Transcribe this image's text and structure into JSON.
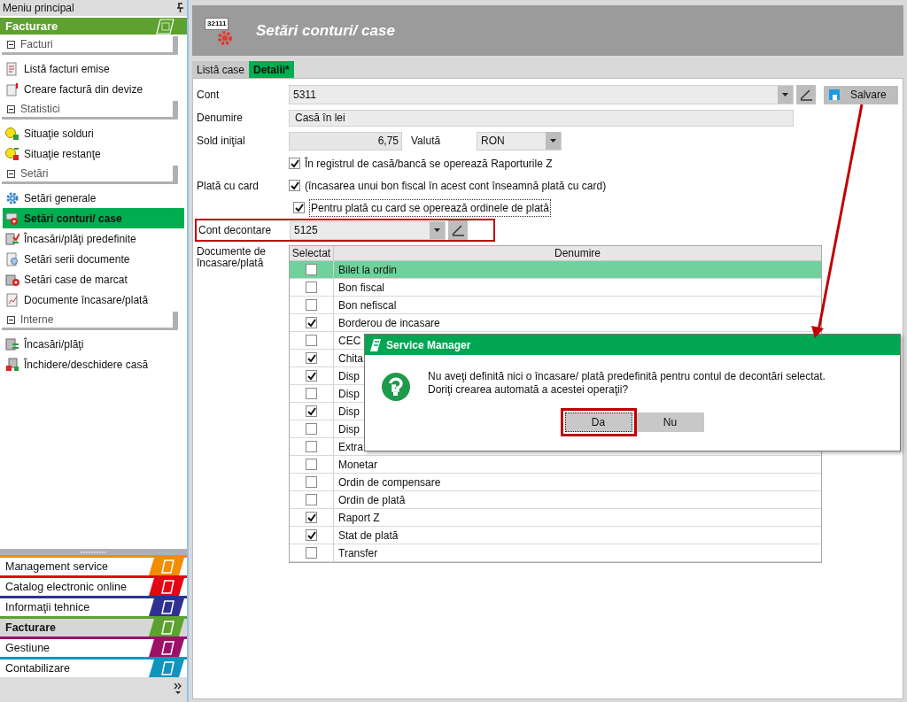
{
  "sidebar": {
    "title": "Meniu principal",
    "module": "Facturare",
    "groups": [
      {
        "label": "Facturi",
        "expanded": true,
        "items": [
          {
            "label": "Listă facturi emise",
            "selected": false
          },
          {
            "label": "Creare factură din devize",
            "selected": false
          }
        ]
      },
      {
        "label": "Statistici",
        "expanded": true,
        "items": [
          {
            "label": "Situaţie solduri",
            "selected": false
          },
          {
            "label": "Situaţie restanţe",
            "selected": false
          }
        ]
      },
      {
        "label": "Setări",
        "expanded": true,
        "items": [
          {
            "label": "Setări generale",
            "selected": false
          },
          {
            "label": "Setări conturi/ case",
            "selected": true
          },
          {
            "label": "Încasări/plăţi predefinite",
            "selected": false
          },
          {
            "label": "Setări serii documente",
            "selected": false
          },
          {
            "label": "Setări case de marcat",
            "selected": false
          },
          {
            "label": "Documente încasare/plată",
            "selected": false
          }
        ]
      },
      {
        "label": "Interne",
        "expanded": true,
        "items": [
          {
            "label": "Încasări/plăţi",
            "selected": false
          },
          {
            "label": "Închidere/deschidere casă",
            "selected": false
          }
        ]
      }
    ],
    "modules": [
      {
        "label": "Management service",
        "color": "#f28c00",
        "selected": false
      },
      {
        "label": "Catalog electronic online",
        "color": "#e30613",
        "selected": false
      },
      {
        "label": "Informaţii tehnice",
        "color": "#2e3192",
        "selected": false
      },
      {
        "label": "Facturare",
        "color": "#5da12e",
        "selected": true
      },
      {
        "label": "Gestiune",
        "color": "#9e1068",
        "selected": false
      },
      {
        "label": "Contabilizare",
        "color": "#0f95bd",
        "selected": false
      }
    ]
  },
  "header": {
    "icon_text": "32111",
    "title": "Setări conturi/ case"
  },
  "tabs": [
    {
      "label": "Listă case",
      "selected": false
    },
    {
      "label": "Detalii*",
      "selected": true
    }
  ],
  "form": {
    "cont_label": "Cont",
    "cont": "5311",
    "denumire_label": "Denumire",
    "denumire": "Casă în lei",
    "sold_label": "Sold iniţial",
    "sold": "6,75",
    "valuta_label": "Valută",
    "valuta": "RON",
    "options": [
      {
        "label": "În registrul de casă/bancă se operează Raporturile Z",
        "checked": true
      },
      {
        "label": "(încasarea unui bon fiscal în acest cont înseamnă plată cu card)",
        "checked": true
      },
      {
        "label": "Pentru plată cu card se operează ordinele de plată",
        "checked": true
      }
    ],
    "card_label": "Plată cu card",
    "decontare_label": "Cont decontare",
    "decontare": "5125",
    "documents_label": "Documente de încasare/plată"
  },
  "save_button": "Salvare",
  "table": {
    "columns": [
      "Selectat",
      "Denumire"
    ],
    "rows": [
      {
        "name": "Bilet la ordin",
        "checked": false,
        "selected": true
      },
      {
        "name": "Bon fiscal",
        "checked": false,
        "selected": false
      },
      {
        "name": "Bon nefiscal",
        "checked": false,
        "selected": false
      },
      {
        "name": "Borderou de incasare",
        "checked": true,
        "selected": false
      },
      {
        "name": "CEC",
        "checked": false,
        "selected": false
      },
      {
        "name": "Chita",
        "checked": true,
        "selected": false
      },
      {
        "name": "Disp",
        "checked": true,
        "selected": false
      },
      {
        "name": "Disp",
        "checked": false,
        "selected": false
      },
      {
        "name": "Disp",
        "checked": true,
        "selected": false
      },
      {
        "name": "Disp",
        "checked": false,
        "selected": false
      },
      {
        "name": "Extra",
        "checked": false,
        "selected": false
      },
      {
        "name": "Monetar",
        "checked": false,
        "selected": false
      },
      {
        "name": "Ordin de compensare",
        "checked": false,
        "selected": false
      },
      {
        "name": "Ordin de plată",
        "checked": false,
        "selected": false
      },
      {
        "name": "Raport Z",
        "checked": true,
        "selected": false
      },
      {
        "name": "Stat de plată",
        "checked": true,
        "selected": false
      },
      {
        "name": "Transfer",
        "checked": false,
        "selected": false
      }
    ]
  },
  "dialog": {
    "title": "Service Manager",
    "message": "Nu aveţi definită nici o încasare/ plată predefinită pentru contul de decontări selectat.\nDoriţi crearea automată a acestei operaţii?",
    "buttons": [
      {
        "label": "Da",
        "selected": true
      },
      {
        "label": "Nu",
        "selected": false
      }
    ]
  }
}
